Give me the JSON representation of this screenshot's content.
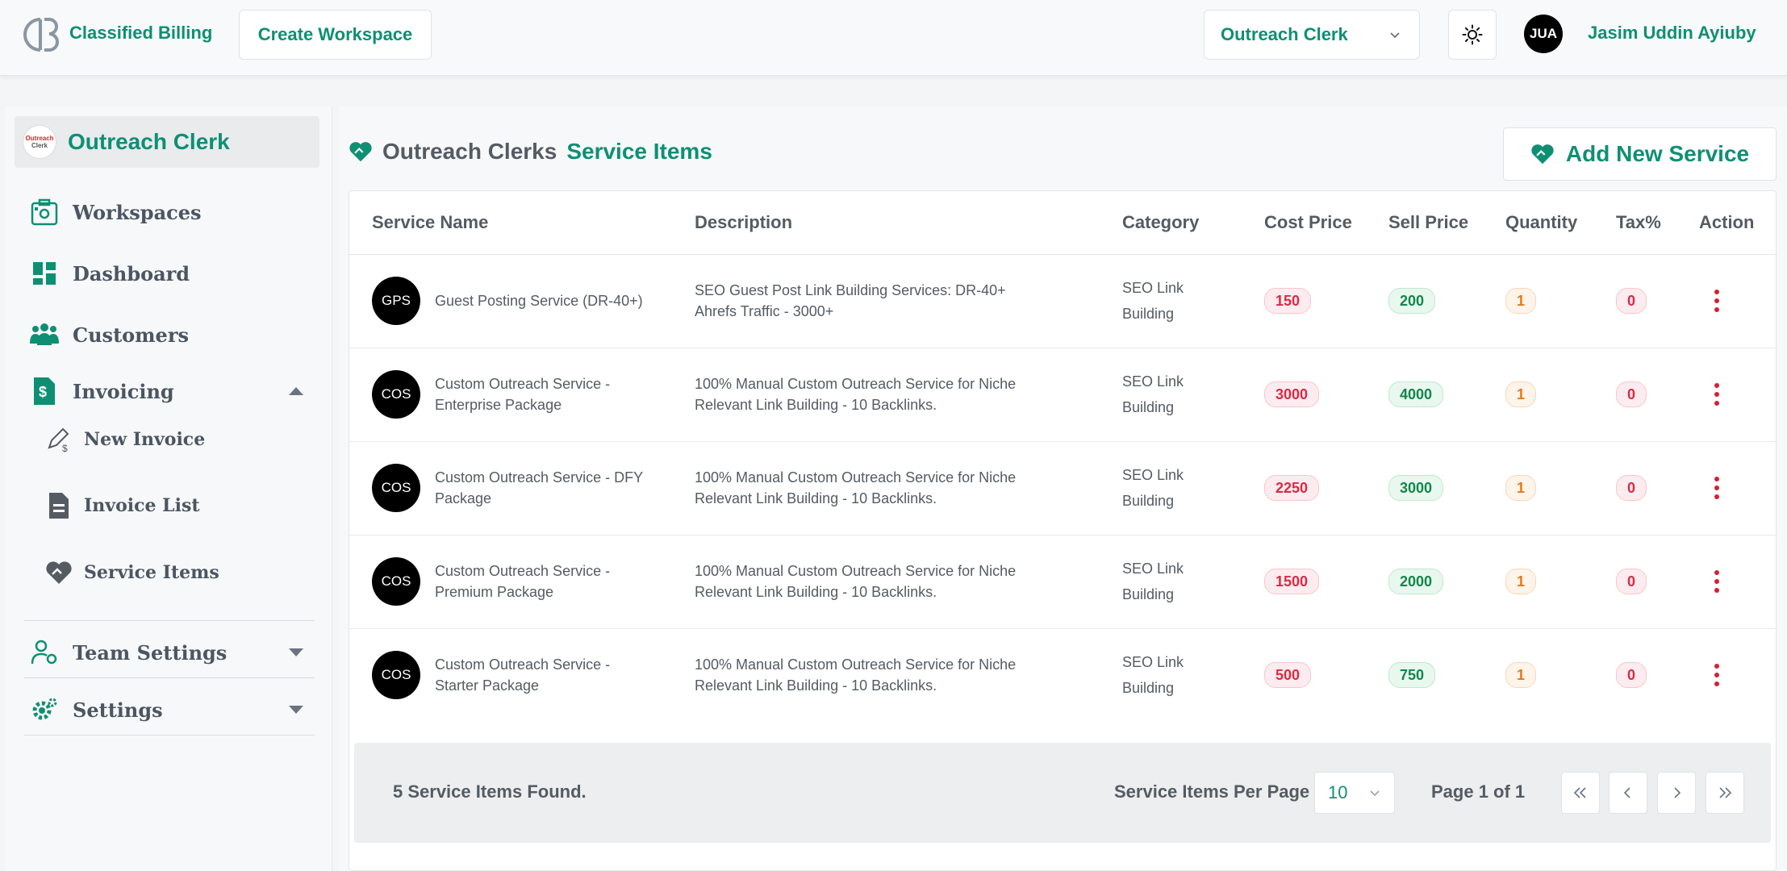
{
  "header": {
    "app_name": "Classified Billing",
    "create_workspace": "Create Workspace",
    "workspace_selected": "Outreach Clerk",
    "user_initials": "JUA",
    "user_name": "Jasim Uddin Ayiuby"
  },
  "sidebar": {
    "workspace_name": "Outreach Clerk",
    "workspace_logo_text": [
      "Outreach",
      "Clerk"
    ],
    "items": [
      {
        "label": "Workspaces",
        "icon": "workspaces-icon"
      },
      {
        "label": "Dashboard",
        "icon": "dashboard-icon"
      },
      {
        "label": "Customers",
        "icon": "customers-icon"
      },
      {
        "label": "Invoicing",
        "icon": "invoice-icon",
        "expanded": true
      },
      {
        "label": "Team Settings",
        "icon": "team-settings-icon"
      },
      {
        "label": "Settings",
        "icon": "settings-gear-icon"
      }
    ],
    "sub_items": [
      {
        "label": "New Invoice",
        "icon": "new-invoice-icon"
      },
      {
        "label": "Invoice List",
        "icon": "invoice-list-icon"
      },
      {
        "label": "Service Items",
        "icon": "service-items-icon"
      }
    ]
  },
  "main": {
    "title_part1": "Outreach Clerks",
    "title_part2": "Service Items",
    "add_button": "Add New Service",
    "columns": [
      "Service Name",
      "Description",
      "Category",
      "Cost Price",
      "Sell Price",
      "Quantity",
      "Tax%",
      "Action"
    ],
    "rows": [
      {
        "abbr": "GPS",
        "name": "Guest Posting Service (DR-40+)",
        "description": "SEO Guest Post Link Building Services: DR-40+ Ahrefs Traffic - 3000+",
        "category": "SEO Link Building",
        "cost": "150",
        "sell": "200",
        "qty": "1",
        "tax": "0"
      },
      {
        "abbr": "COS",
        "name": "Custom Outreach Service - Enterprise Package",
        "description": "100% Manual Custom Outreach Service for Niche Relevant Link Building - 10 Backlinks.",
        "category": "SEO Link Building",
        "cost": "3000",
        "sell": "4000",
        "qty": "1",
        "tax": "0"
      },
      {
        "abbr": "COS",
        "name": "Custom Outreach Service - DFY Package",
        "description": "100% Manual Custom Outreach Service for Niche Relevant Link Building - 10 Backlinks.",
        "category": "SEO Link Building",
        "cost": "2250",
        "sell": "3000",
        "qty": "1",
        "tax": "0"
      },
      {
        "abbr": "COS",
        "name": "Custom Outreach Service - Premium Package",
        "description": "100% Manual Custom Outreach Service for Niche Relevant Link Building - 10 Backlinks.",
        "category": "SEO Link Building",
        "cost": "1500",
        "sell": "2000",
        "qty": "1",
        "tax": "0"
      },
      {
        "abbr": "COS",
        "name": "Custom Outreach Service - Starter Package",
        "description": "100% Manual Custom Outreach Service for Niche Relevant Link Building - 10 Backlinks.",
        "category": "SEO Link Building",
        "cost": "500",
        "sell": "750",
        "qty": "1",
        "tax": "0"
      }
    ],
    "footer": {
      "found": "5 Service Items Found.",
      "per_page_label": "Service Items Per Page",
      "per_page_value": "10",
      "page_info": "Page 1 of 1"
    }
  },
  "colors": {
    "accent": "#0e8f74",
    "cost": "#dc2a45",
    "sell": "#12864c",
    "qty": "#e37a1a"
  }
}
